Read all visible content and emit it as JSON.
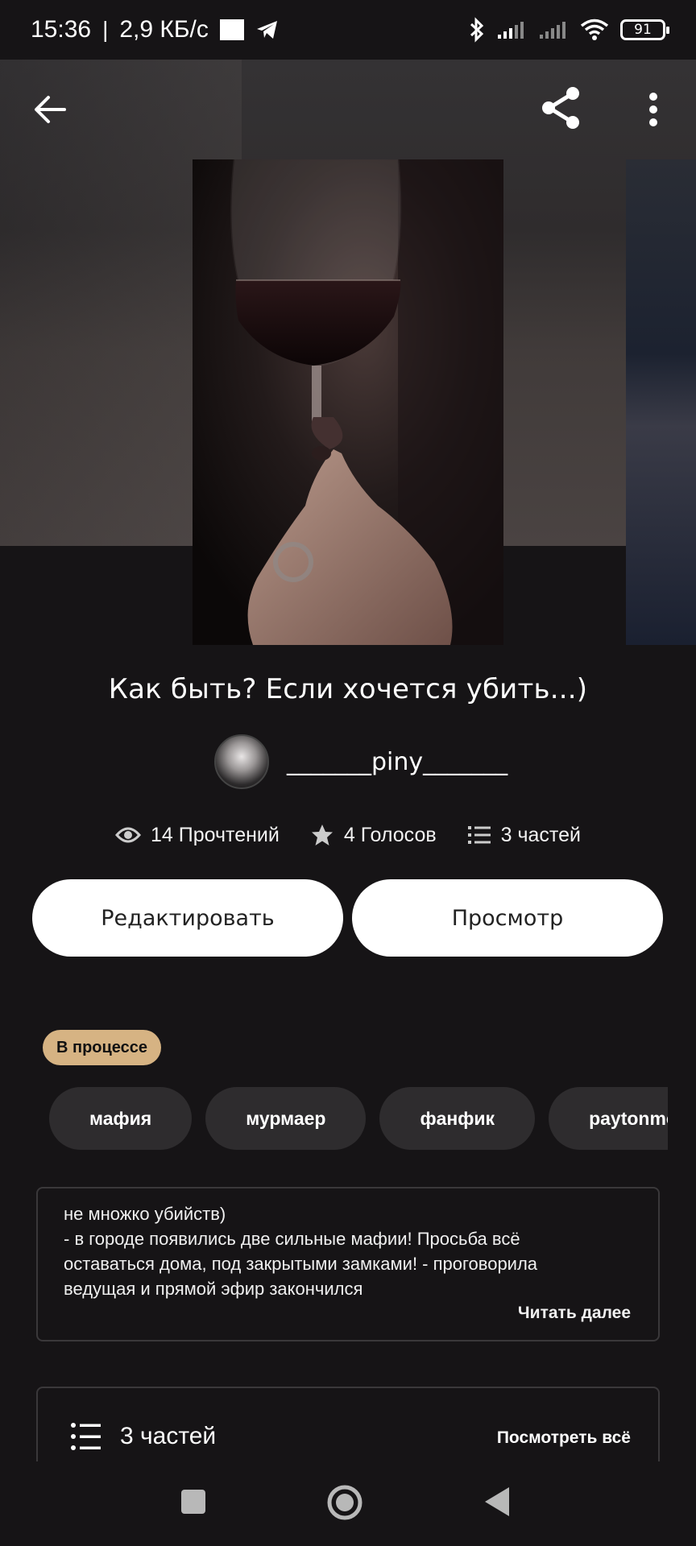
{
  "status_bar": {
    "time": "15:36",
    "speed": "2,9 КБ/с",
    "battery": "91",
    "icons": [
      "bluetooth-icon",
      "signal-icon",
      "signal-icon",
      "wifi-icon",
      "battery-icon",
      "telegram-icon"
    ]
  },
  "toolbar": {
    "back_icon": "arrow-left-icon",
    "share_icon": "share-icon",
    "more_icon": "more-vertical-icon"
  },
  "story": {
    "title": "Как быть? Если хочется убить...)",
    "author": "_______piny_______",
    "stats": {
      "reads": "14 Прочтений",
      "votes": "4 Голосов",
      "parts": "3 частей"
    },
    "status_badge": "В процессе",
    "tags": [
      "мафия",
      "мурмаер",
      "фанфик",
      "paytonmoormeier"
    ],
    "description_lines": [
      "не множко убийств)",
      "- в городе появились две сильные мафии! Просьба всё",
      "оставаться дома, под закрытыми замками! - проговорила",
      "ведущая и прямой эфир закончился"
    ],
    "read_more": "Читать далее"
  },
  "actions": {
    "edit": "Редактировать",
    "view": "Просмотр"
  },
  "parts_section": {
    "title": "3 частей",
    "see_all": "Посмотреть всё"
  },
  "colors": {
    "background": "#161416",
    "badge": "#d6b383",
    "tag_bg": "#2e2c2e",
    "button_bg": "#ffffff"
  }
}
